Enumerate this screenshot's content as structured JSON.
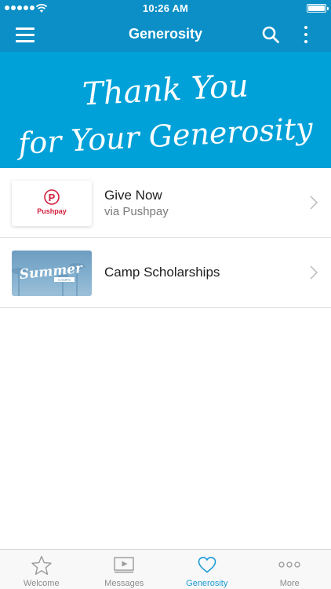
{
  "status_bar": {
    "time": "10:26 AM"
  },
  "nav": {
    "title": "Generosity",
    "menu_icon": "hamburger-menu-icon",
    "search_icon": "search-icon",
    "more_icon": "vertical-dots-icon"
  },
  "banner": {
    "line1": "Thank You",
    "line2": "for Your Generosity"
  },
  "list": [
    {
      "title": "Give Now",
      "subtitle": "via Pushpay",
      "thumb_text": "Pushpay",
      "thumb_logo_letter": "P"
    },
    {
      "title": "Camp Scholarships",
      "thumb_text": "Summer",
      "thumb_subtext": "CAMPS"
    }
  ],
  "tabs": [
    {
      "label": "Welcome",
      "icon": "star-icon",
      "active": false
    },
    {
      "label": "Messages",
      "icon": "play-video-icon",
      "active": false
    },
    {
      "label": "Generosity",
      "icon": "heart-icon",
      "active": true
    },
    {
      "label": "More",
      "icon": "more-dots-icon",
      "active": false
    }
  ],
  "colors": {
    "brand_blue": "#0b8fc6",
    "banner_blue": "#00a1d8",
    "active_tab": "#1a9bd6",
    "pushpay_red": "#d21f3c"
  }
}
